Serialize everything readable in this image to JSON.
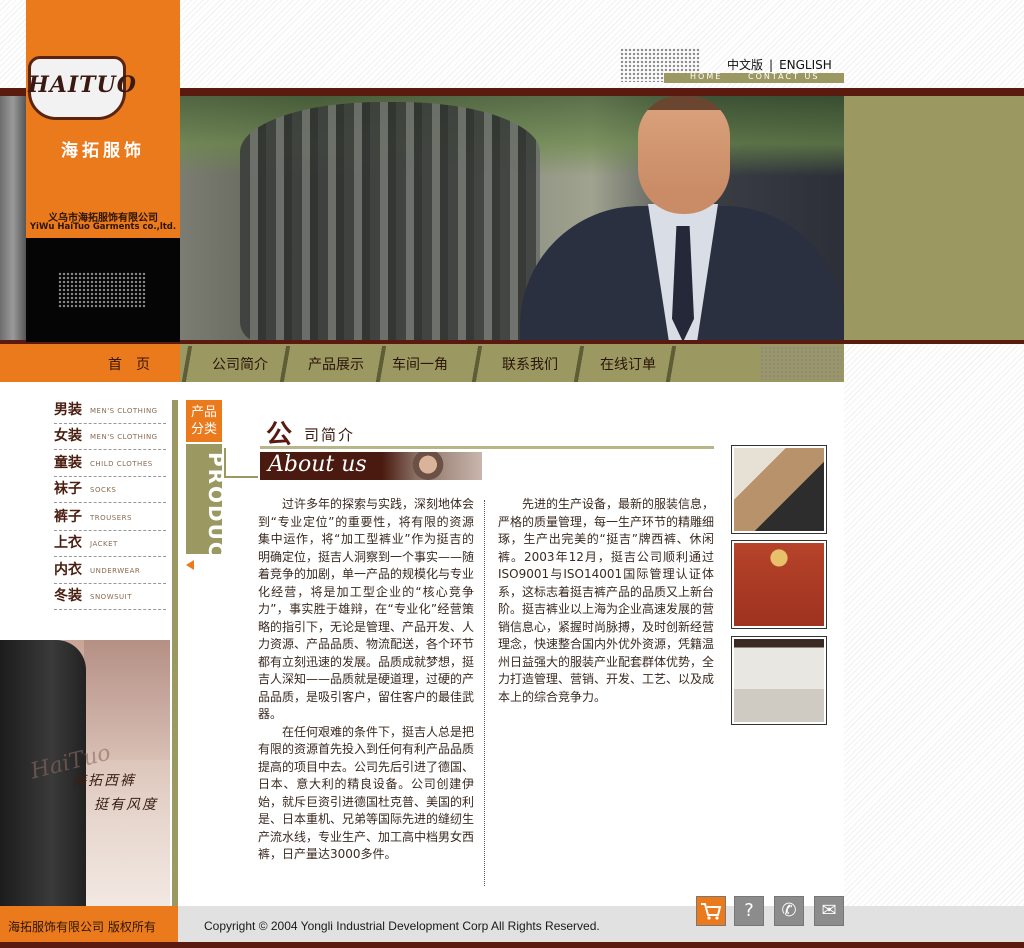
{
  "brand": {
    "logo_text": "HAITUO",
    "name_cn": "海拓服饰",
    "company_cn": "义乌市海拓服饰有限公司",
    "company_en": "YiWu HaiTuo Garments co.,ltd."
  },
  "top_nav": {
    "lang_cn": "中文版",
    "separator": "|",
    "lang_en": "ENGLISH",
    "home": "HOME",
    "contact": "CONTACT US"
  },
  "main_nav": {
    "home": "首页",
    "items": [
      {
        "label": "公司简介"
      },
      {
        "label": "产品展示"
      },
      {
        "label": "车间一角"
      },
      {
        "label": "联系我们"
      },
      {
        "label": "在线订单"
      }
    ]
  },
  "categories": [
    {
      "cn": "男装",
      "en": "MEN'S CLOTHING"
    },
    {
      "cn": "女装",
      "en": "MEN'S CLOTHING"
    },
    {
      "cn": "童装",
      "en": "CHILD CLOTHES"
    },
    {
      "cn": "袜子",
      "en": "SOCKS"
    },
    {
      "cn": "裤子",
      "en": "TROUSERS"
    },
    {
      "cn": "上衣",
      "en": "JACKET"
    },
    {
      "cn": "内衣",
      "en": "UNDERWEAR"
    },
    {
      "cn": "冬装",
      "en": "SNOWSUIT"
    }
  ],
  "side_banner": {
    "line1": "海拓西裤",
    "line2": "挺有风度",
    "signature": "HaiTuo"
  },
  "products_tab": {
    "label_line1": "产品",
    "label_line2": "分类",
    "vertical": "PRODUCTS"
  },
  "about": {
    "title_first": "公",
    "title_rest": "司简介",
    "title_en": "About us",
    "col1": [
      "过许多年的探索与实践，深刻地体会到“专业定位”的重要性，将有限的资源集中运作，将“加工型裤业”作为挺吉的明确定位，挺吉人洞察到一个事实——随着竞争的加剧，单一产品的规模化与专业化经营，将是加工型企业的“核心竞争力”，事实胜于雄辩，在“专业化”经营策略的指引下，无论是管理、产品开发、人力资源、产品品质、物流配送，各个环节都有立刻迅速的发展。品质成就梦想，挺吉人深知——品质就是硬道理，过硬的产品品质，是吸引客户，留住客户的最佳武器。",
      "在任何艰难的条件下，挺吉人总是把有限的资源首先投入到任何有利产品品质提高的项目中去。公司先后引进了德国、日本、意大利的精良设备。公司创建伊始，就斥巨资引进德国杜克普、美国的利是、日本重机、兄弟等国际先进的缝纫生产流水线，专业生产、加工高中档男女西裤，日产量达3000多件。"
    ],
    "col2": [
      "先进的生产设备，最新的服装信息，严格的质量管理，每一生产环节的精雕细琢，生产出完美的“挺吉”牌西裤、休闲裤。2003年12月，挺吉公司顺利通过ISO9001与ISO14001国际管理认证体系，这标志着挺吉裤产品的品质又上新台阶。挺吉裤业以上海为企业高速发展的营销信息心，紧握时尚脉搏，及时创新经营理念，快速整合国内外优外资源，凭籍温州日益强大的服装产业配套群体优势，全力打造管理、营销、开发、工艺、以及成本上的综合竞争力。"
    ]
  },
  "footer": {
    "company_cn": "海拓服饰有限公司 版权所有",
    "copyright": "Copyright © 2004 Yongli Industrial Development Corp All Rights Reserved."
  },
  "icons": {
    "cart": "cart-icon",
    "help": "help-icon",
    "phone": "phone-icon",
    "mail": "mail-icon",
    "help_glyph": "?",
    "phone_glyph": "✆",
    "mail_glyph": "✉",
    "cart_glyph": "🛒"
  },
  "colors": {
    "orange": "#ea7a1c",
    "olive": "#9b9862",
    "maroon": "#5a1a10"
  }
}
